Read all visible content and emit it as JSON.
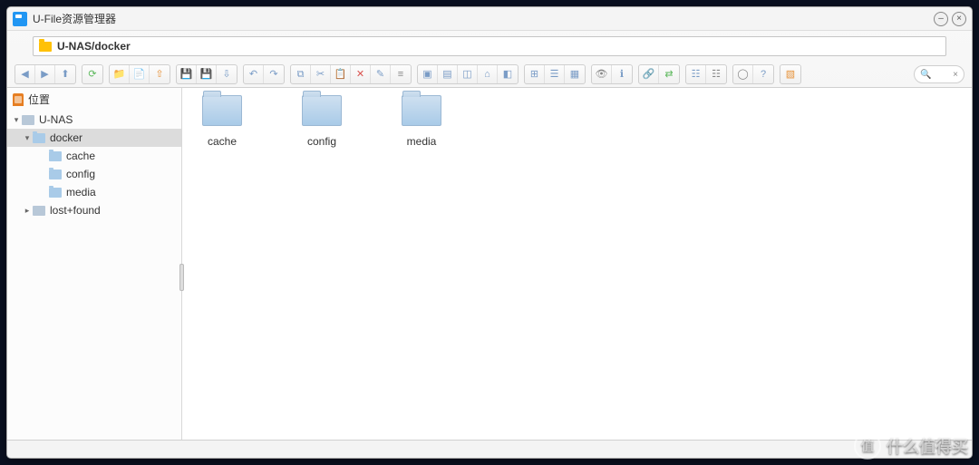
{
  "window": {
    "title": "U-File资源管理器",
    "minimize_glyph": "–",
    "close_glyph": "×"
  },
  "path": {
    "value": "U-NAS/docker"
  },
  "toolbar_groups": [
    {
      "name": "nav",
      "buttons": [
        {
          "name": "back-button",
          "glyph": "◀",
          "cls": ""
        },
        {
          "name": "forward-button",
          "glyph": "▶",
          "cls": ""
        },
        {
          "name": "up-button",
          "glyph": "⬆",
          "cls": ""
        }
      ]
    },
    {
      "name": "refresh",
      "buttons": [
        {
          "name": "refresh-button",
          "glyph": "⟳",
          "cls": "green"
        }
      ]
    },
    {
      "name": "new",
      "buttons": [
        {
          "name": "new-folder-button",
          "glyph": "📁",
          "cls": ""
        },
        {
          "name": "new-file-button",
          "glyph": "📄",
          "cls": ""
        },
        {
          "name": "upload-button",
          "glyph": "⇧",
          "cls": "orange"
        }
      ]
    },
    {
      "name": "disk",
      "buttons": [
        {
          "name": "save-button",
          "glyph": "💾",
          "cls": ""
        },
        {
          "name": "save-as-button",
          "glyph": "💾",
          "cls": "gray"
        },
        {
          "name": "download-button",
          "glyph": "⇩",
          "cls": ""
        }
      ]
    },
    {
      "name": "history",
      "buttons": [
        {
          "name": "undo-button",
          "glyph": "↶",
          "cls": ""
        },
        {
          "name": "redo-button",
          "glyph": "↷",
          "cls": ""
        }
      ]
    },
    {
      "name": "edit",
      "buttons": [
        {
          "name": "copy-button",
          "glyph": "⧉",
          "cls": ""
        },
        {
          "name": "cut-button",
          "glyph": "✂",
          "cls": ""
        },
        {
          "name": "paste-button",
          "glyph": "📋",
          "cls": ""
        },
        {
          "name": "delete-button",
          "glyph": "✕",
          "cls": "red"
        },
        {
          "name": "rename-button",
          "glyph": "✎",
          "cls": ""
        },
        {
          "name": "properties-button",
          "glyph": "≡",
          "cls": "gray"
        }
      ]
    },
    {
      "name": "archive",
      "buttons": [
        {
          "name": "compress-button",
          "glyph": "▣",
          "cls": ""
        },
        {
          "name": "extract-button",
          "glyph": "▤",
          "cls": ""
        },
        {
          "name": "archive-3-button",
          "glyph": "◫",
          "cls": ""
        },
        {
          "name": "archive-4-button",
          "glyph": "⌂",
          "cls": ""
        },
        {
          "name": "archive-5-button",
          "glyph": "◧",
          "cls": ""
        }
      ]
    },
    {
      "name": "view",
      "buttons": [
        {
          "name": "view-icons-button",
          "glyph": "⊞",
          "cls": ""
        },
        {
          "name": "view-list-button",
          "glyph": "☰",
          "cls": ""
        },
        {
          "name": "view-details-button",
          "glyph": "▦",
          "cls": ""
        }
      ]
    },
    {
      "name": "visibility",
      "buttons": [
        {
          "name": "preview-button",
          "glyph": "👁",
          "cls": "gray"
        },
        {
          "name": "info-button",
          "glyph": "ℹ",
          "cls": ""
        }
      ]
    },
    {
      "name": "share",
      "buttons": [
        {
          "name": "share-button",
          "glyph": "🔗",
          "cls": "orange"
        },
        {
          "name": "sync-button",
          "glyph": "⇄",
          "cls": "green"
        }
      ]
    },
    {
      "name": "sort",
      "buttons": [
        {
          "name": "sort-asc-button",
          "glyph": "☷",
          "cls": ""
        },
        {
          "name": "sort-desc-button",
          "glyph": "☷",
          "cls": "gray"
        }
      ]
    },
    {
      "name": "help",
      "buttons": [
        {
          "name": "settings-button",
          "glyph": "◯",
          "cls": "gray"
        },
        {
          "name": "help-button",
          "glyph": "?",
          "cls": ""
        }
      ]
    },
    {
      "name": "misc",
      "buttons": [
        {
          "name": "palette-button",
          "glyph": "▧",
          "cls": "orange"
        }
      ]
    }
  ],
  "sidebar": {
    "header_label": "位置",
    "tree": [
      {
        "name": "unas",
        "label": "U-NAS",
        "level": 0,
        "icon": "drive",
        "expanded": true,
        "selected": false
      },
      {
        "name": "docker",
        "label": "docker",
        "level": 1,
        "icon": "folder",
        "expanded": true,
        "selected": true
      },
      {
        "name": "cache",
        "label": "cache",
        "level": 2,
        "icon": "folder",
        "expanded": false,
        "selected": false
      },
      {
        "name": "config",
        "label": "config",
        "level": 2,
        "icon": "folder",
        "expanded": false,
        "selected": false
      },
      {
        "name": "media",
        "label": "media",
        "level": 2,
        "icon": "folder",
        "expanded": false,
        "selected": false
      },
      {
        "name": "lostfound",
        "label": "lost+found",
        "level": 1,
        "icon": "drive",
        "expanded": false,
        "selected": false
      }
    ]
  },
  "content": {
    "items": [
      {
        "name": "cache",
        "label": "cache",
        "type": "folder"
      },
      {
        "name": "config",
        "label": "config",
        "type": "folder"
      },
      {
        "name": "media",
        "label": "media",
        "type": "folder"
      }
    ]
  },
  "watermark": {
    "badge": "值",
    "text": "什么值得买"
  }
}
